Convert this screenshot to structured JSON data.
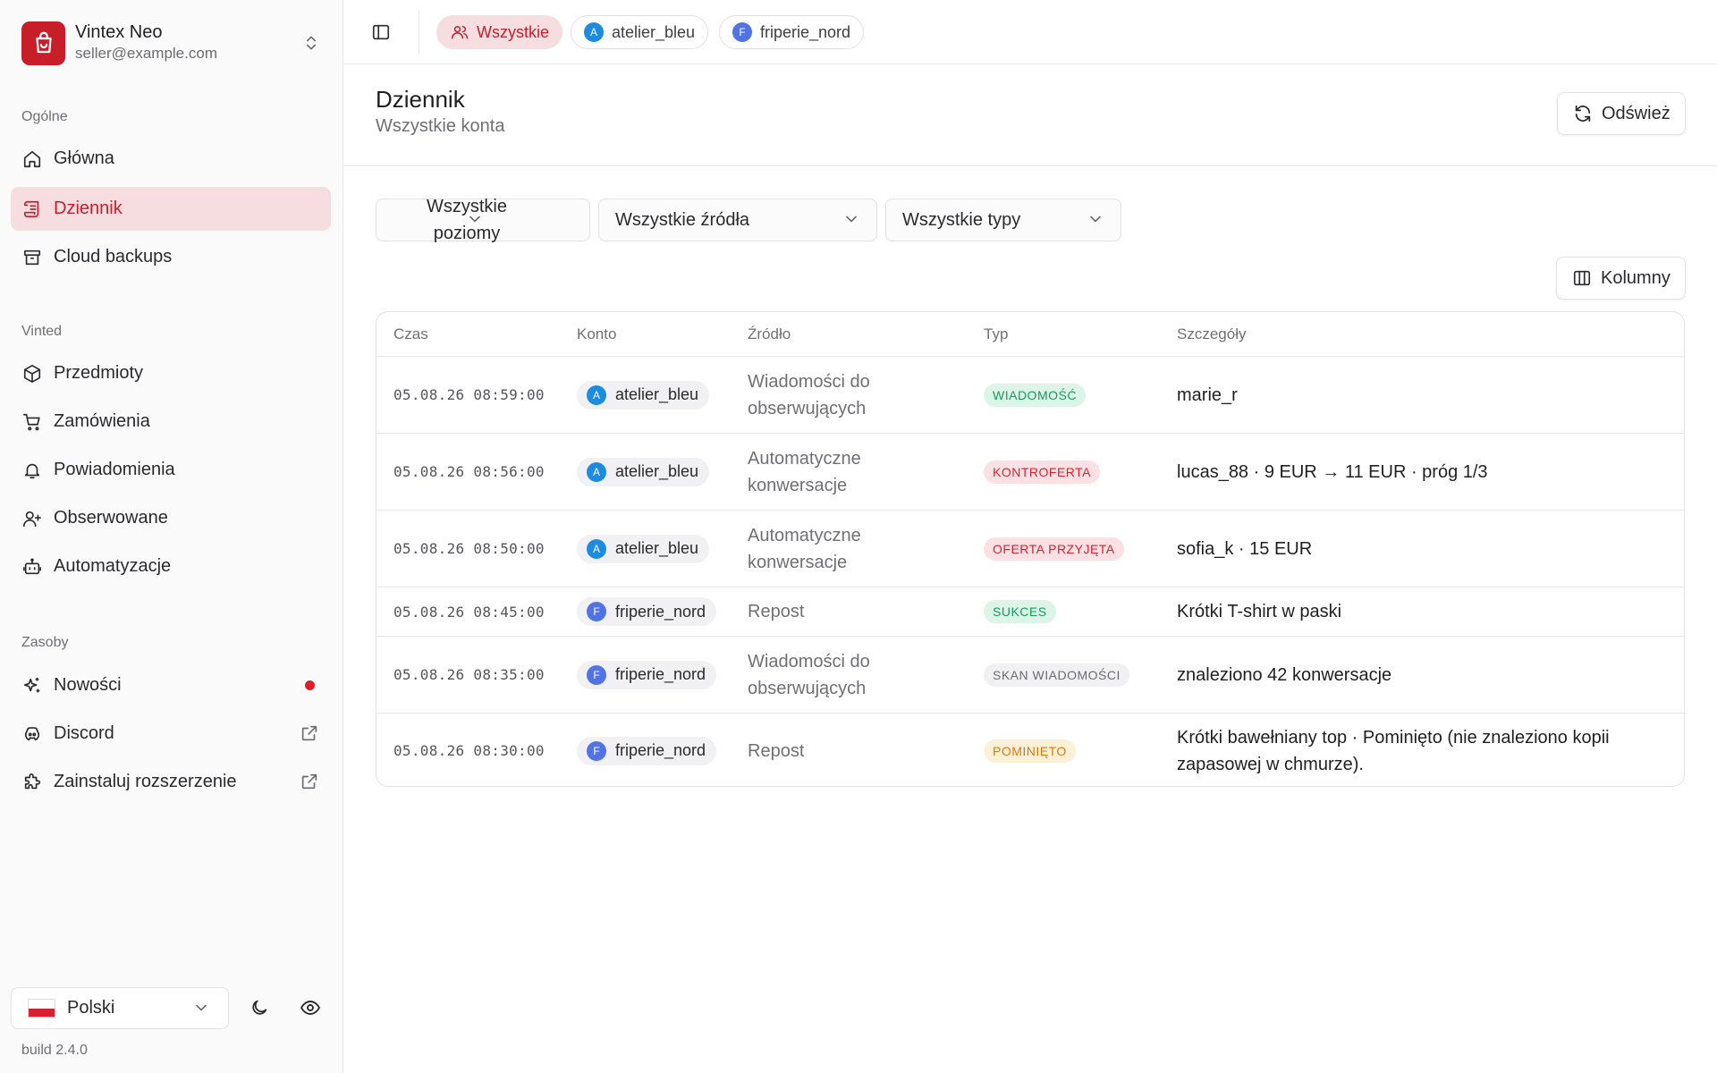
{
  "brand": {
    "name": "Vintex Neo",
    "email": "seller@example.com"
  },
  "sidebar": {
    "sections": [
      {
        "label": "Ogólne",
        "items": [
          {
            "label": "Główna",
            "icon": "home-icon"
          },
          {
            "label": "Dziennik",
            "icon": "log-icon",
            "active": true
          },
          {
            "label": "Cloud backups",
            "icon": "archive-icon"
          }
        ]
      },
      {
        "label": "Vinted",
        "items": [
          {
            "label": "Przedmioty",
            "icon": "box-icon"
          },
          {
            "label": "Zamówienia",
            "icon": "cart-icon"
          },
          {
            "label": "Powiadomienia",
            "icon": "bell-icon"
          },
          {
            "label": "Obserwowane",
            "icon": "user-plus-icon"
          },
          {
            "label": "Automatyzacje",
            "icon": "bot-icon"
          }
        ]
      },
      {
        "label": "Zasoby",
        "items": [
          {
            "label": "Nowości",
            "icon": "sparkles-icon",
            "badge": "unread-dot"
          },
          {
            "label": "Discord",
            "icon": "discord-icon",
            "external": true
          },
          {
            "label": "Zainstaluj rozszerzenie",
            "icon": "puzzle-icon",
            "external": true
          }
        ]
      }
    ],
    "language": "Polski",
    "build": "build 2.4.0"
  },
  "topbar": {
    "chips": [
      {
        "label": "Wszystkie",
        "active": true
      },
      {
        "label": "atelier_bleu",
        "avatar": "A"
      },
      {
        "label": "friperie_nord",
        "avatar": "F"
      }
    ]
  },
  "page": {
    "title": "Dziennik",
    "subtitle": "Wszystkie konta",
    "refresh_label": "Odśwież",
    "columns_label": "Kolumny"
  },
  "filters": {
    "levels": "Wszystkie poziomy",
    "sources": "Wszystkie źródła",
    "types": "Wszystkie typy"
  },
  "table": {
    "headers": [
      "Czas",
      "Konto",
      "Źródło",
      "Typ",
      "Szczegóły"
    ],
    "rows": [
      {
        "time": "05.08.26 08:59:00",
        "account": "atelier_bleu",
        "avatar": "A",
        "source": "Wiadomości do obserwujących",
        "type": "WIADOMOŚĆ",
        "type_color": "green",
        "details": "marie_r"
      },
      {
        "time": "05.08.26 08:56:00",
        "account": "atelier_bleu",
        "avatar": "A",
        "source": "Automatyczne konwersacje",
        "type": "KONTROFERTA",
        "type_color": "red",
        "details": "lucas_88 · 9 EUR → 11 EUR · próg 1/3"
      },
      {
        "time": "05.08.26 08:50:00",
        "account": "atelier_bleu",
        "avatar": "A",
        "source": "Automatyczne konwersacje",
        "type": "OFERTA PRZYJĘTA",
        "type_color": "red",
        "details": "sofia_k · 15 EUR"
      },
      {
        "time": "05.08.26 08:45:00",
        "account": "friperie_nord",
        "avatar": "F",
        "source": "Repost",
        "type": "SUKCES",
        "type_color": "green",
        "details": "Krótki T-shirt w paski"
      },
      {
        "time": "05.08.26 08:35:00",
        "account": "friperie_nord",
        "avatar": "F",
        "source": "Wiadomości do obserwujących",
        "type": "SKAN WIADOMOŚCI",
        "type_color": "gray",
        "details": "znaleziono 42 konwersacje"
      },
      {
        "time": "05.08.26 08:30:00",
        "account": "friperie_nord",
        "avatar": "F",
        "source": "Repost",
        "type": "POMINIĘTO",
        "type_color": "orange",
        "details": "Krótki bawełniany top · Pominięto (nie znaleziono kopii zapasowej w chmurze)."
      }
    ]
  },
  "colors": {
    "accent": "#c81e2a",
    "active_bg": "#f5dde0"
  }
}
